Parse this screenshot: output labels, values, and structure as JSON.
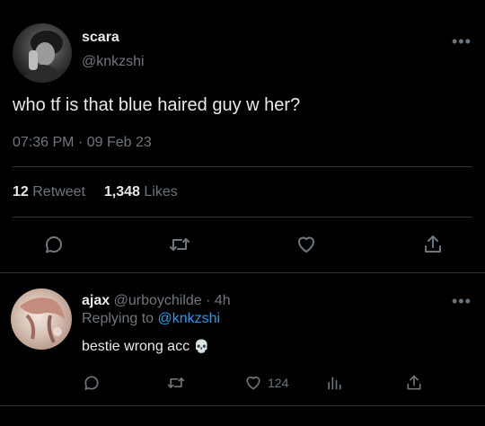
{
  "tweet": {
    "display_name": "scara",
    "handle": "@knkzshi",
    "text": "who tf is that blue haired guy w her?",
    "timestamp": "07:36 PM · 09 Feb 23",
    "retweet_count": "12",
    "retweet_label": "Retweet",
    "likes_count": "1,348",
    "likes_label": "Likes"
  },
  "reply": {
    "display_name": "ajax",
    "handle_time": "@urboychilde · 4h",
    "replying_prefix": "Replying to",
    "replying_to": "@knkzshi",
    "text": "bestie wrong acc",
    "emoji": "💀",
    "like_count": "124"
  },
  "colors": {
    "background": "#000000",
    "muted": "#6e767d",
    "link": "#1d9bf0",
    "divider": "#2f3336"
  },
  "icons": [
    "more-icon",
    "reply-icon",
    "retweet-icon",
    "like-icon",
    "share-icon",
    "analytics-icon"
  ]
}
